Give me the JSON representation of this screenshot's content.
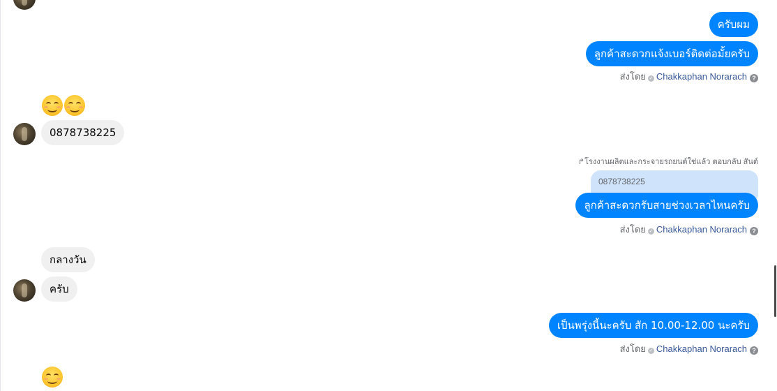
{
  "messages": {
    "out_1": "ครับผม",
    "out_2": "ลูกค้าสะดวกแจ้งเบอร์ติดต่อมั้ยครับ",
    "in_phone": "0878738225",
    "reply_label": "โรงงานผลิตและกระจายรถยนต์ใช่แล้ว ตอบกลับ สันต์",
    "quoted_text": "0878738225",
    "out_3": "ลูกค้าสะดวกรับสายช่วงเวลาไหนครับ",
    "in_1": "กลางวัน",
    "in_2": "ครับ",
    "out_4": "เป็นพรุ่งนี้นะครับ สัก 10.00-12.00 นะครับ"
  },
  "sent_by": {
    "prefix": "ส่งโดย",
    "name": "Chakkaphan Norarach",
    "help_glyph": "?"
  },
  "icons": {
    "reply": "reply-arrow-icon",
    "emoji": "smiling-face-icon",
    "verified": "check-circle-icon",
    "help": "help-circle-icon"
  },
  "colors": {
    "outgoing_bubble": "#0084ff",
    "incoming_bubble": "#f0f0f0",
    "quoted_bubble": "#cfe3fb",
    "sender_name": "#385898"
  }
}
